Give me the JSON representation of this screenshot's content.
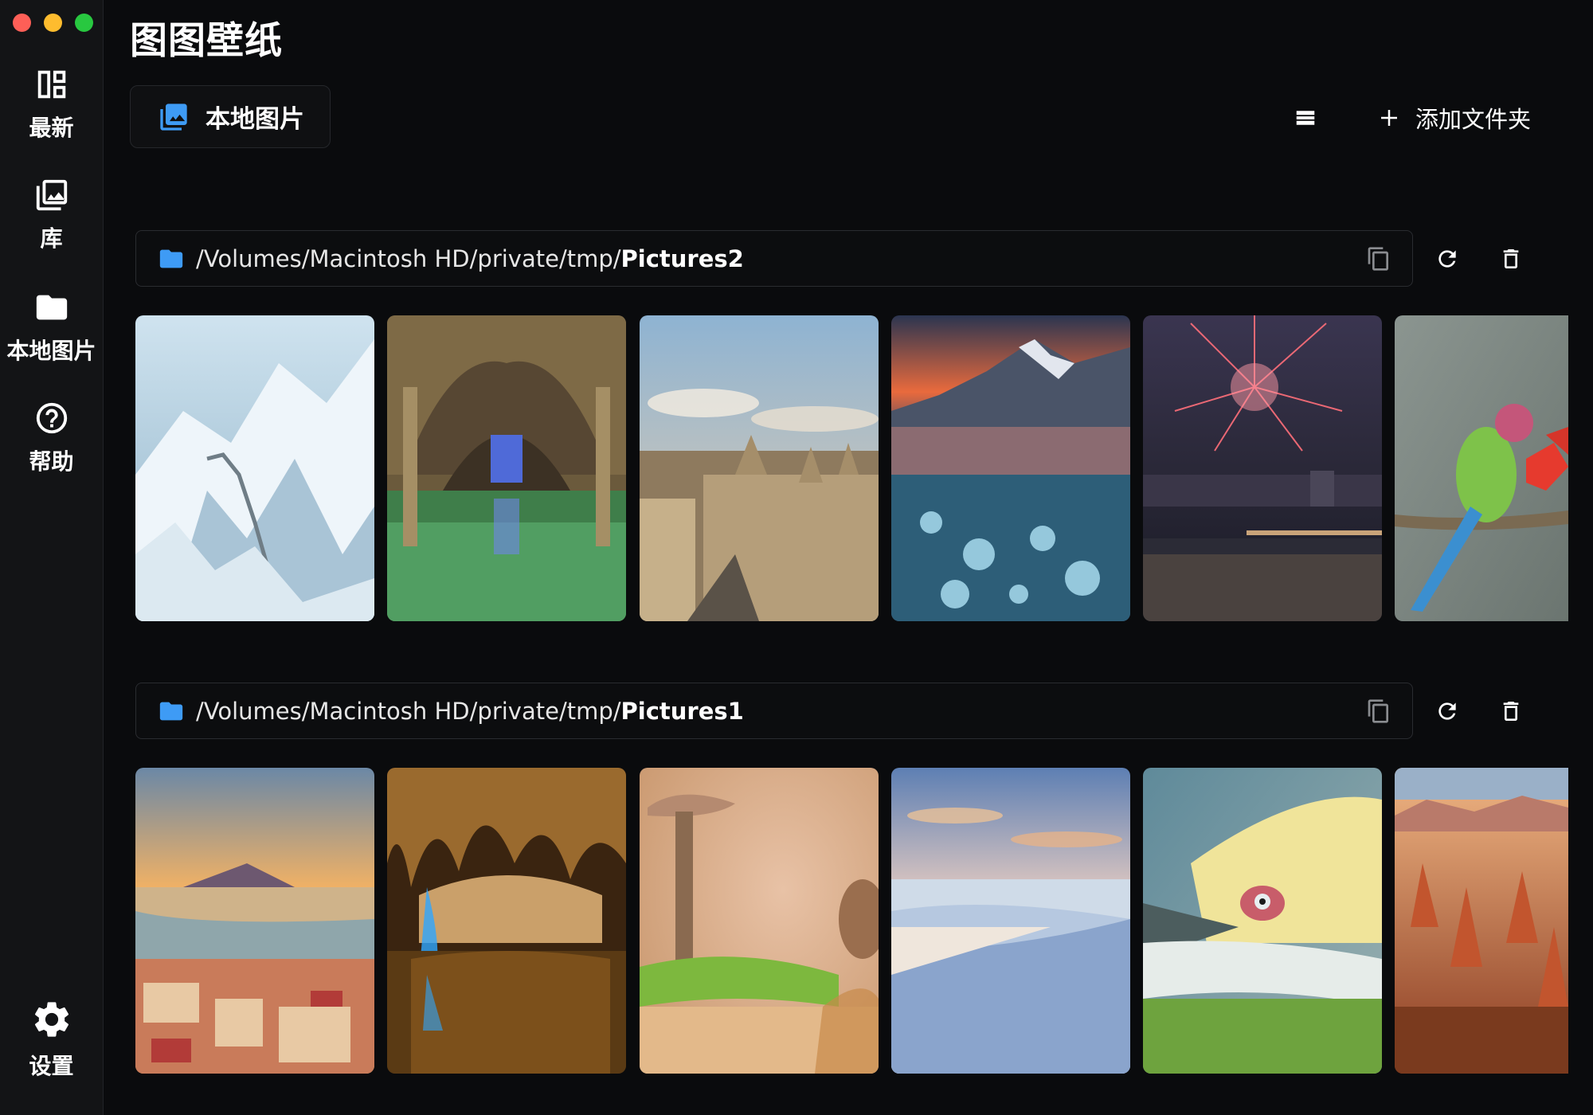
{
  "app": {
    "title": "图图壁纸"
  },
  "sidebar": {
    "items": [
      {
        "label": "最新",
        "icon": "dashboard-icon"
      },
      {
        "label": "库",
        "icon": "photo-library-icon"
      },
      {
        "label": "本地图片",
        "icon": "folder-icon"
      },
      {
        "label": "帮助",
        "icon": "help-icon"
      }
    ],
    "settings": {
      "label": "设置",
      "icon": "gear-icon"
    }
  },
  "header": {
    "tab_label": "本地图片",
    "add_folder_label": "添加文件夹"
  },
  "folders": [
    {
      "path_prefix": "/Volumes/Macintosh HD/private/tmp/",
      "path_name": "Pictures2",
      "thumbnails": [
        "snowy great wall",
        "flooded crypt arches",
        "oxford city skyline",
        "frozen lake bubbles at sunset",
        "fireworks over river city",
        "green parrot on branch"
      ]
    },
    {
      "path_prefix": "/Volumes/Macintosh HD/private/tmp/",
      "path_name": "Pictures1",
      "thumbnails": [
        "naples bay sunset",
        "illuminated cave lake",
        "mushroom and squirrel",
        "white sand dunes",
        "pelican close-up",
        "red rock pinnacles"
      ]
    }
  ],
  "colors": {
    "accent": "#3e9bf5",
    "background": "#0a0b0d",
    "sidebar": "#131416"
  }
}
